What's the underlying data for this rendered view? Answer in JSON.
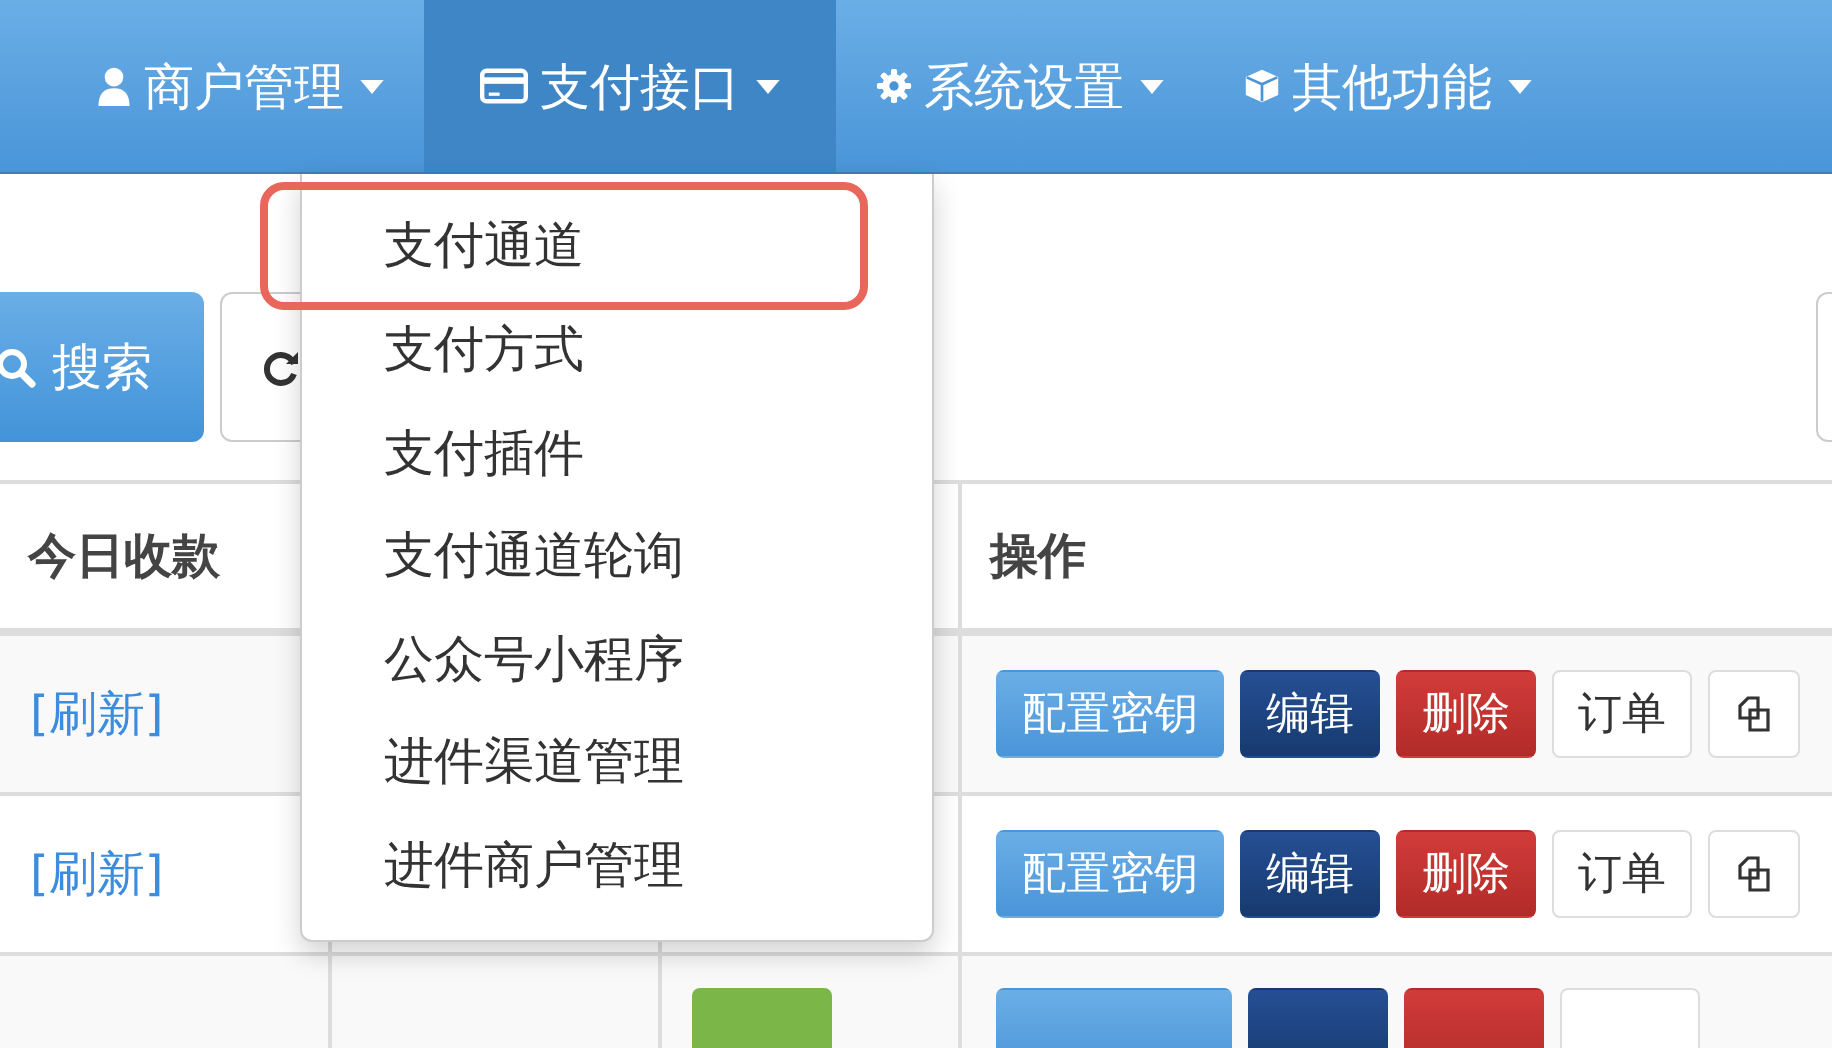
{
  "navbar": {
    "items": [
      {
        "label": "商户管理",
        "selected": false
      },
      {
        "label": "支付接口",
        "selected": true
      },
      {
        "label": "系统设置",
        "selected": false
      },
      {
        "label": "其他功能",
        "selected": false
      }
    ]
  },
  "toolbar": {
    "search_button": "搜索"
  },
  "dropdown": {
    "items": [
      {
        "label": "支付通道",
        "highlighted": true
      },
      {
        "label": "支付方式",
        "highlighted": false
      },
      {
        "label": "支付插件",
        "highlighted": false
      },
      {
        "label": "支付通道轮询",
        "highlighted": false
      },
      {
        "label": "公众号小程序",
        "highlighted": false
      },
      {
        "label": "进件渠道管理",
        "highlighted": false
      },
      {
        "label": "进件商户管理",
        "highlighted": false
      }
    ]
  },
  "table": {
    "columns": [
      "今日收款",
      "",
      "",
      "操作"
    ],
    "rows": [
      {
        "today": "[刷新]",
        "actions": [
          "配置密钥",
          "编辑",
          "删除",
          "订单"
        ]
      },
      {
        "today": "[刷新]",
        "actions": [
          "配置密钥",
          "编辑",
          "删除",
          "订单"
        ]
      }
    ],
    "partial_row": {
      "status_on": true
    }
  }
}
